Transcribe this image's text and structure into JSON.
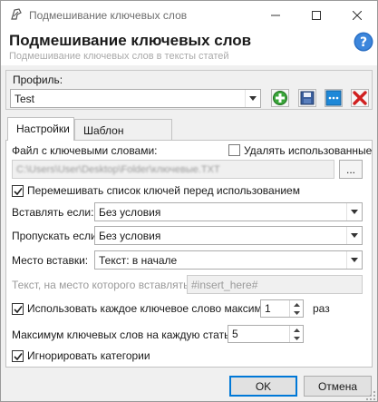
{
  "window": {
    "title": "Подмешивание ключевых слов"
  },
  "header": {
    "title": "Подмешивание ключевых слов",
    "subtitle": "Подмешивание ключевых слов в тексты статей"
  },
  "profile": {
    "label": "Профиль:",
    "value": "Test"
  },
  "tabs": [
    {
      "label": "Настройки",
      "active": true
    },
    {
      "label": "Шаблон вставки",
      "active": false
    }
  ],
  "settings": {
    "keyword_file_label": "Файл с ключевыми словами:",
    "remove_used_label": "Удалять использованные",
    "remove_used_checked": false,
    "file_path": "C:\\Users\\User\\Desktop\\Folder\\ключевые.TXT",
    "browse_label": "...",
    "shuffle_label": "Перемешивать список ключей перед использованием",
    "shuffle_checked": true,
    "insert_if_label": "Вставлять если:",
    "insert_if_value": "Без условия",
    "skip_if_label": "Пропускать если:",
    "skip_if_value": "Без условия",
    "insert_place_label": "Место вставки:",
    "insert_place_value": "Текст: в начале",
    "replace_text_label": "Текст, на место которого вставлять:",
    "replace_text_value": "#insert_here#",
    "use_max_label": "Использовать каждое ключевое слово максимум",
    "use_max_checked": true,
    "use_max_value": "1",
    "use_max_unit": "раз",
    "max_per_article_label": "Максимум ключевых слов на каждую статью:",
    "max_per_article_value": "5",
    "ignore_categories_label": "Игнорировать категории",
    "ignore_categories_checked": true
  },
  "footer": {
    "ok_label": "OK",
    "cancel_label": "Отмена"
  },
  "colors": {
    "accent": "#0078d7",
    "add_green": "#2e8b2e",
    "delete_red": "#d02020",
    "help_blue": "#2a6fc4"
  }
}
